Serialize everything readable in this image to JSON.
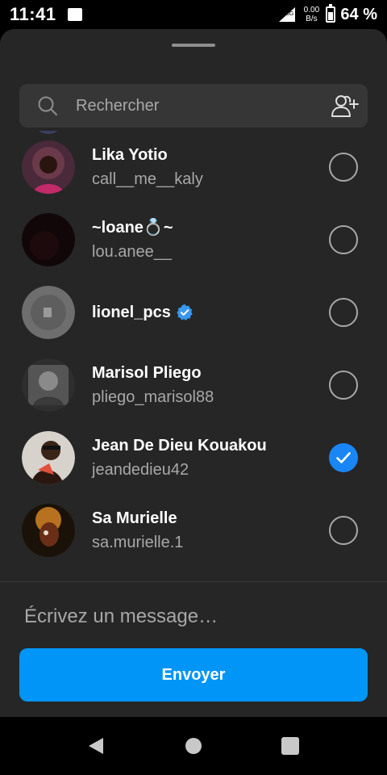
{
  "status_bar": {
    "time": "11:41",
    "network_type": "3G",
    "speed_value": "0.00",
    "speed_unit": "B/s",
    "battery": "64 %",
    "battery_level": 0.64
  },
  "search": {
    "placeholder": "Rechercher"
  },
  "contacts": [
    {
      "name": "Lika Yotio",
      "username": "call__me__kaly",
      "selected": false,
      "verified": false,
      "avatar_color": "#6b3a4a"
    },
    {
      "name": "~loane💍~",
      "username": "lou.anee__",
      "selected": false,
      "verified": false,
      "avatar_color": "#1a0b0d"
    },
    {
      "name": "lionel_pcs",
      "username": "",
      "selected": false,
      "verified": true,
      "avatar_color": "#6e6e6e"
    },
    {
      "name": "Marisol Pliego",
      "username": "pliego_marisol88",
      "selected": false,
      "verified": false,
      "avatar_color": "#5a5a5a"
    },
    {
      "name": "Jean De Dieu Kouakou",
      "username": "jeandedieu42",
      "selected": true,
      "verified": false,
      "avatar_color": "#c9b6a8"
    },
    {
      "name": "Sa Murielle",
      "username": "sa.murielle.1",
      "selected": false,
      "verified": false,
      "avatar_color": "#7a3b1e"
    }
  ],
  "composer": {
    "placeholder": "Écrivez un message…",
    "send_label": "Envoyer"
  },
  "colors": {
    "accent": "#0095f6",
    "sheet_bg": "#262626",
    "search_bg": "#363636",
    "muted_text": "#a8a8a8"
  }
}
